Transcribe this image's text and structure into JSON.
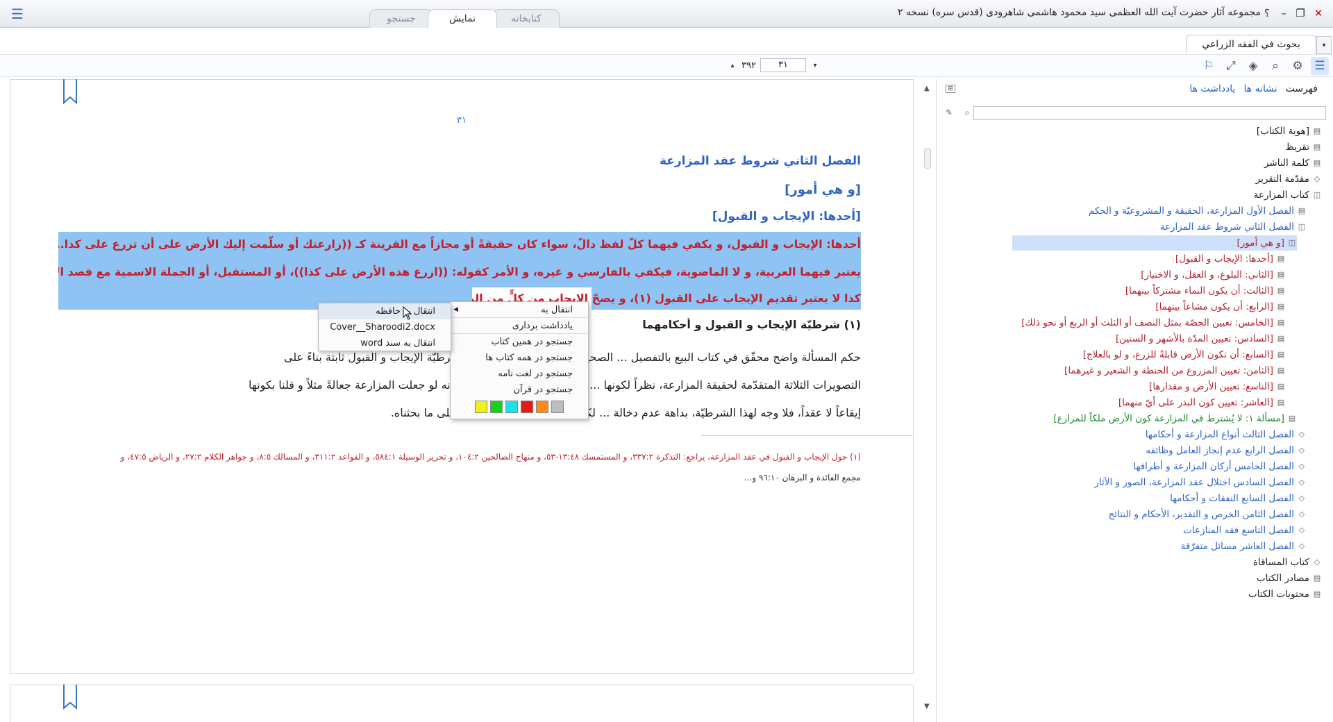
{
  "titlebar": {
    "title": "مجموعه آثار حضرت آيت الله العظمی سيد محمود هاشمی شاهرودی (قدس سره) نسخه ۲",
    "tabs": [
      {
        "label": "کتابخانه",
        "active": false
      },
      {
        "label": "نمايش",
        "active": true
      },
      {
        "label": "جستجو",
        "active": false
      }
    ],
    "help": "؟",
    "minimize": "–",
    "restore": "❐",
    "close": "✕"
  },
  "book_tab": {
    "label": "بحوث في الفقه الزراعي",
    "dropdown": "▾"
  },
  "pagenav": {
    "current": "۳۱",
    "total": "۳۹۲",
    "prev": "▴",
    "next": "▾"
  },
  "toolbar_icons": [
    "list-icon",
    "gear-icon",
    "search-icon",
    "layers-icon",
    "expand-icon",
    "bookmark-icon"
  ],
  "document": {
    "page_number": "۳۱",
    "heading1": "الفصل الثاني شروط عقد المزارعة",
    "heading2": "[و هي أمور]",
    "heading3": "[أحدها: الإيجاب و القبول]",
    "selected_lines": [
      "أحدها: الإيجاب و القبول، و يكفي فيهما كلّ لفظ دالّ، سواء كان حقيقةً أو مجازاً مع القرينة كـ ((زارعتك أو سلّمت إليك الأرض على أن تزرع على كذا...))، و لا",
      "يعتبر فيهما العربية، و لا الماضوية، فيكفي بالفارسي و غيره، و الأمر كقوله: ((ازرع هذه الأرض على كذا))، أو المستقبل، أو الجملة الاسمية مع قصد الإنشاء بها، و",
      "كذا لا يعتبر تقديم الإيجاب على القبول (١)، و يصحّ الإيجاب من كلٍّ من المالك"
    ],
    "subheading": "(١) شرطيّة الإيجاب و القبول و أحكامهما",
    "para_lines": [
      "حكم المسألة واضح محقّق في كتاب البيع بالتفصيل ... الصحيح، إلا أن هنا نكتة و هي: إن شرطيّة الإيجاب و القبول ثابتة بناءً على",
      "التصويرات الثلاثة المتقدّمة لحقيقة المزارعة، نظراً لكونها ... فلا بد فيه من كلا الأمرين، إلا أنه لو جعلت المزارعة جعالةً مثلاً و قلنا بكونها",
      "إيقاعاً لا عقداً، فلا وجه لهذا الشرطيّة، بداهة عدم دخالة ... لكون الجعالة عقداً هو الصحيح على ما بحثناه."
    ],
    "footnote_lines": [
      "(١) حول الإيجاب و القبول في عقد المزارعة، يراجع: التذكرة ٣٣٧:٢، و المستمسك ١٣:٤٨-٥٣، و منهاج الصالحين ١٠٤:٢، و تحرير الوسيلة ٥٨٤:١، و القواعد ٣١١:٢، و المسالك ٨:٥، و جواهر الكلام ٢٧:٢، و الرياض ٤٧:٥، و",
      "مجمع الفائدة و البرهان ٩٦:١٠ و..."
    ]
  },
  "context_menu": {
    "items": [
      {
        "label": "انتقال به",
        "has_submenu": true
      },
      {
        "label": "يادداشت برداری"
      },
      {
        "label": "جستجو در همين کتاب"
      },
      {
        "label": "جستجو در همه کتاب ها"
      },
      {
        "label": "جستجو در لغت نامه"
      },
      {
        "label": "جستجو در قرآن"
      }
    ],
    "swatches": [
      "#bdbdbd",
      "#ff8c1a",
      "#e81919",
      "#22e0ea",
      "#1ad11a",
      "#f2f21a"
    ]
  },
  "submenu": {
    "items": [
      {
        "label": "انتقال به حافظه"
      },
      {
        "label": "Cover__Sharoodi2.docx"
      },
      {
        "label": "انتقال به سند word"
      }
    ]
  },
  "right_panel": {
    "tabs": [
      {
        "label": "فهرست",
        "active": true
      },
      {
        "label": "نشانه ها",
        "active": false
      },
      {
        "label": "يادداشت ها",
        "active": false
      }
    ],
    "search_placeholder": "",
    "tree": [
      {
        "label": "[هوية الكتاب]",
        "level": 0,
        "icon": "page-icon"
      },
      {
        "label": "تقريظ",
        "level": 0,
        "icon": "page-icon"
      },
      {
        "label": "كلمة الناشر",
        "level": 0,
        "icon": "page-icon"
      },
      {
        "label": "مقدّمة التقرير",
        "level": 0,
        "icon": "chapter-icon"
      },
      {
        "label": "كتاب المزارعة",
        "level": 0,
        "icon": "book-icon"
      },
      {
        "label": "الفصل الأول المزارعة، الحقيقة و المشروعيّة و الحكم",
        "level": 1,
        "icon": "page-icon"
      },
      {
        "label": "الفصل الثاني شروط عقد المزارعة",
        "level": 1,
        "icon": "book-icon"
      },
      {
        "label": "[و هي أمور]",
        "level": 2,
        "icon": "book-icon",
        "selected": true
      },
      {
        "label": "[أحدها: الإيجاب و القبول]",
        "level": 3,
        "icon": "page-icon"
      },
      {
        "label": "[الثاني: البلوغ، و العقل، و الاختيار]",
        "level": 3,
        "icon": "page-icon"
      },
      {
        "label": "[الثالث: أن يكون النماء مشتركاً بينهما]",
        "level": 3,
        "icon": "page-icon"
      },
      {
        "label": "[الرابع: أن يكون مشاعاً بينهما]",
        "level": 3,
        "icon": "page-icon"
      },
      {
        "label": "[الخامس: تعيين الحصّة بمثل النصف أو الثلث أو الربع أو نحو ذلك]",
        "level": 3,
        "icon": "page-icon"
      },
      {
        "label": "[السادس: تعيين المدّة بالأشهر و السنين]",
        "level": 3,
        "icon": "page-icon"
      },
      {
        "label": "[السابع: أن تكون الأرض قابلةً للزرع، و لو بالعلاج]",
        "level": 3,
        "icon": "page-icon"
      },
      {
        "label": "[الثامن: تعيين المزروع من الحنطة و الشعير و غيرهما]",
        "level": 3,
        "icon": "page-icon"
      },
      {
        "label": "[التاسع: تعيين الأرض و مقدارها]",
        "level": 3,
        "icon": "page-icon"
      },
      {
        "label": "[العاشر: تعيين كون البذر على أيّ منهما]",
        "level": 3,
        "icon": "page-icon"
      },
      {
        "label": "[مسألة ١: لا يُشترط في المزارعة كون الأرض ملكاً للمزارع]",
        "level": 2,
        "icon": "page-icon",
        "green": true
      },
      {
        "label": "الفصل الثالث أنواع المزارعة و أحكامها",
        "level": 1,
        "icon": "chapter-icon"
      },
      {
        "label": "الفصل الرابع عدم إنجاز العامل وظائفه",
        "level": 1,
        "icon": "chapter-icon"
      },
      {
        "label": "الفصل الخامس أركان المزارعة و أطرافها",
        "level": 1,
        "icon": "chapter-icon"
      },
      {
        "label": "الفصل السادس اختلال عقد المزارعة، الصور و الآثار",
        "level": 1,
        "icon": "chapter-icon"
      },
      {
        "label": "الفصل السابع النفقات و أحكامها",
        "level": 1,
        "icon": "chapter-icon"
      },
      {
        "label": "الفصل الثامن الخرص و التقدير، الأحكام و النتائج",
        "level": 1,
        "icon": "chapter-icon"
      },
      {
        "label": "الفصل التاسع فقه المنازعات",
        "level": 1,
        "icon": "chapter-icon"
      },
      {
        "label": "الفصل العاشر مسائل متفرّقة",
        "level": 1,
        "icon": "chapter-icon"
      },
      {
        "label": "كتاب المساقاة",
        "level": 0,
        "icon": "chapter-icon"
      },
      {
        "label": "مصادر الكتاب",
        "level": 0,
        "icon": "page-icon"
      },
      {
        "label": "محتويات الكتاب",
        "level": 0,
        "icon": "page-icon"
      }
    ]
  }
}
